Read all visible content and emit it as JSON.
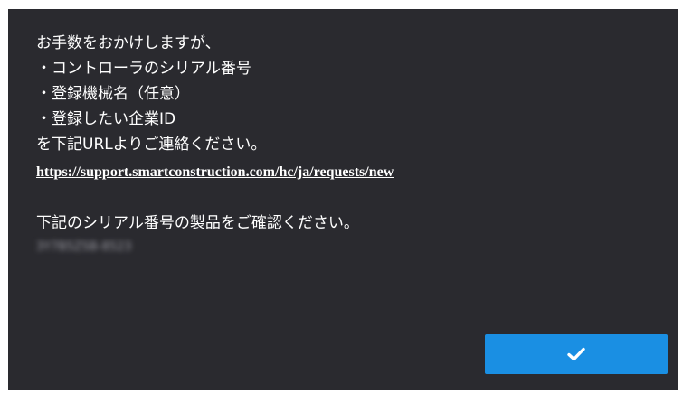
{
  "dialog": {
    "lines": [
      "お手数をおかけしますが、",
      "・コントローラのシリアル番号",
      "・登録機械名（任意）",
      "・登録したい企業ID",
      "を下記URLよりご連絡ください。"
    ],
    "link_text": "https://support.smartconstruction.com/hc/ja/requests/new",
    "confirm_text": "下記のシリアル番号の製品をご確認ください。",
    "serial_number": "3Y7B5ZSB-8523"
  },
  "button": {
    "icon": "checkmark-icon",
    "color": "#1a8fe3"
  },
  "colors": {
    "dialog_background": "#2a2a2f",
    "text": "#ffffff"
  }
}
